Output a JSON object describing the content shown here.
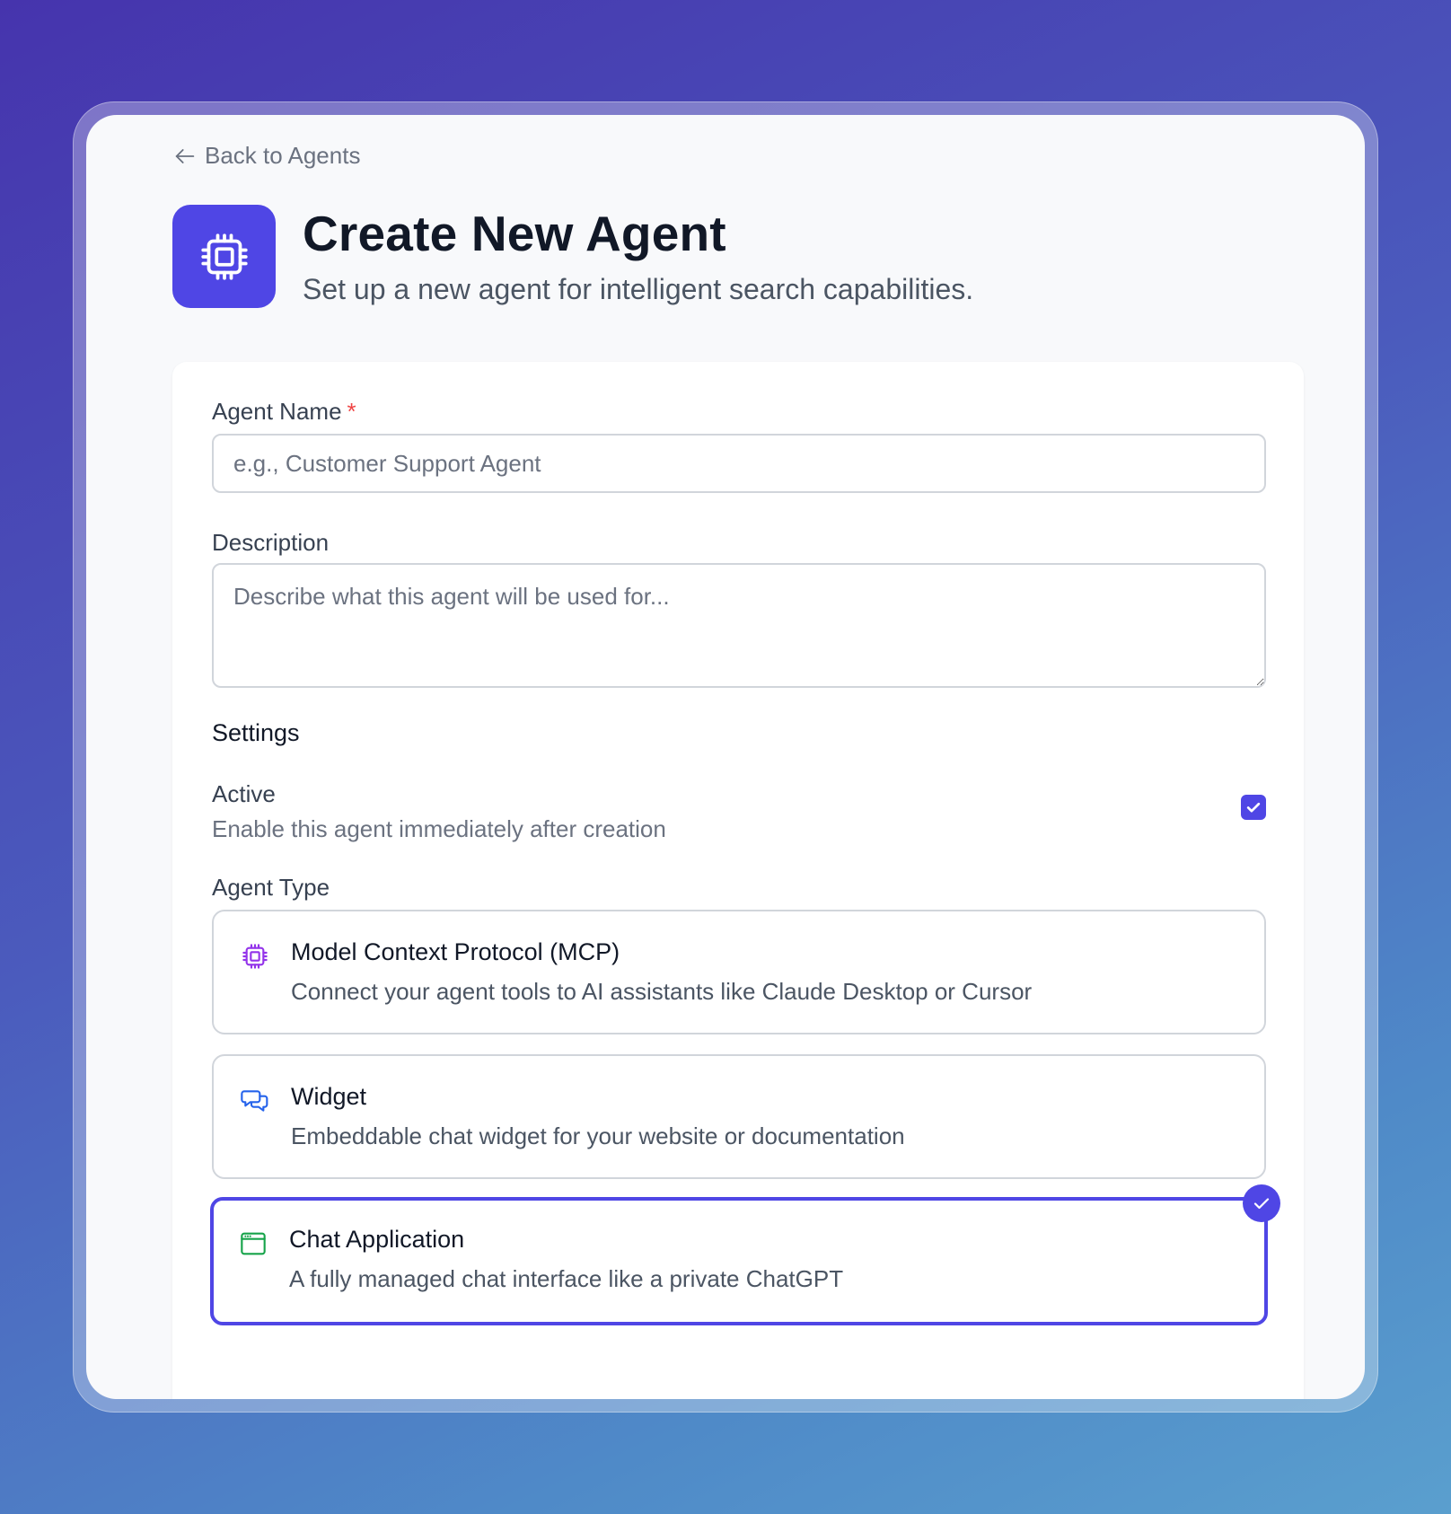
{
  "nav": {
    "back_label": "Back to Agents"
  },
  "header": {
    "title": "Create New Agent",
    "subtitle": "Set up a new agent for intelligent search capabilities."
  },
  "form": {
    "name": {
      "label": "Agent Name",
      "required_mark": "*",
      "placeholder": "e.g., Customer Support Agent",
      "value": ""
    },
    "description": {
      "label": "Description",
      "placeholder": "Describe what this agent will be used for...",
      "value": ""
    },
    "settings": {
      "heading": "Settings",
      "active": {
        "title": "Active",
        "description": "Enable this agent immediately after creation",
        "checked": true
      }
    },
    "agent_type": {
      "label": "Agent Type",
      "selected": "chat-application",
      "options": [
        {
          "id": "mcp",
          "icon": "cpu-chip-icon",
          "icon_color": "#9333ea",
          "title": "Model Context Protocol (MCP)",
          "description": "Connect your agent tools to AI assistants like Claude Desktop or Cursor"
        },
        {
          "id": "widget",
          "icon": "chat-bubbles-icon",
          "icon_color": "#2563eb",
          "title": "Widget",
          "description": "Embeddable chat widget for your website or documentation"
        },
        {
          "id": "chat-application",
          "icon": "browser-window-icon",
          "icon_color": "#16a34a",
          "title": "Chat Application",
          "description": "A fully managed chat interface like a private ChatGPT"
        }
      ]
    }
  },
  "colors": {
    "accent": "#4f46e5",
    "required": "#ef4444"
  }
}
